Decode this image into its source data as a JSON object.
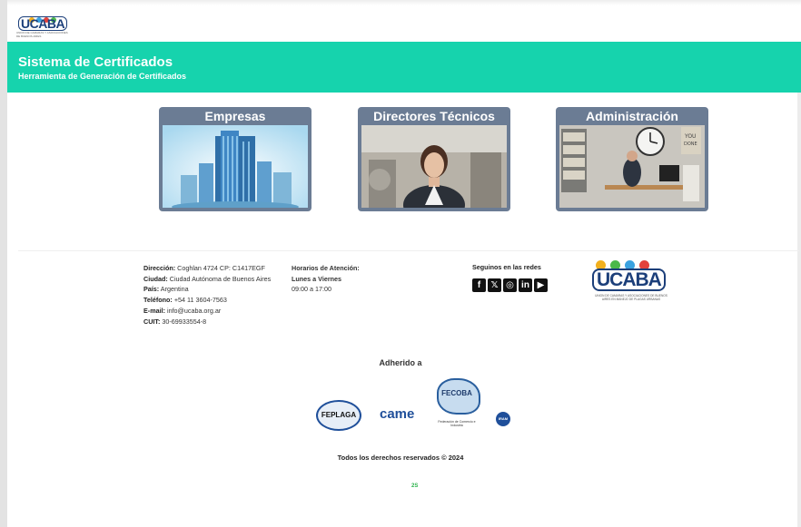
{
  "topbar": {
    "logo_text": "UCABA",
    "logo_tagline": "UNION DE CAMARAS Y ASOCIACIONES DE BUENOS AIRES"
  },
  "header": {
    "title": "Sistema de Certificados",
    "subtitle": "Herramienta de Generación de Certificados"
  },
  "cards": [
    {
      "label": "Empresas"
    },
    {
      "label": "Directores Técnicos"
    },
    {
      "label": "Administración"
    }
  ],
  "footer": {
    "contact": {
      "address_label": "Dirección:",
      "address": "Coghlan 4724 CP: C1417EGF",
      "city_label": "Ciudad:",
      "city": "Ciudad Autónoma de Buenos Aires",
      "country_label": "País:",
      "country": "Argentina",
      "phone_label": "Teléfono:",
      "phone": "+54 11 3604-7563",
      "email_label": "E-mail:",
      "email": "info@ucaba.org.ar",
      "cuit_label": "CUIT:",
      "cuit": "30-69933554-8"
    },
    "hours": {
      "title": "Horarios de Atención:",
      "days": "Lunes a Viernes",
      "time": "09:00 a 17:00"
    },
    "social": {
      "title": "Seguinos en las redes",
      "icons": [
        "facebook-icon",
        "x-icon",
        "instagram-icon",
        "linkedin-icon",
        "youtube-icon"
      ]
    },
    "logo": {
      "text": "UCABA",
      "tagline": "UNION DE CAMARAS Y ASOCIACIONES DE BUENOS AIRES EN MANEJO DE PLAGAS URBANAS"
    },
    "adherido": "Adherido a",
    "partners": {
      "feplaga": "FEPLAGA",
      "came": "came",
      "fecoba": "FECOBA",
      "fecoba_sub": "Federación de Comercio e Industria",
      "iram": "IRAM"
    },
    "copyright": "Todos los derechos reservados © 2024",
    "credit": "2S"
  },
  "colors": {
    "header_bg": "#16d3ad",
    "card_frame": "#6b7c94",
    "brand_blue": "#1c3f7a"
  }
}
